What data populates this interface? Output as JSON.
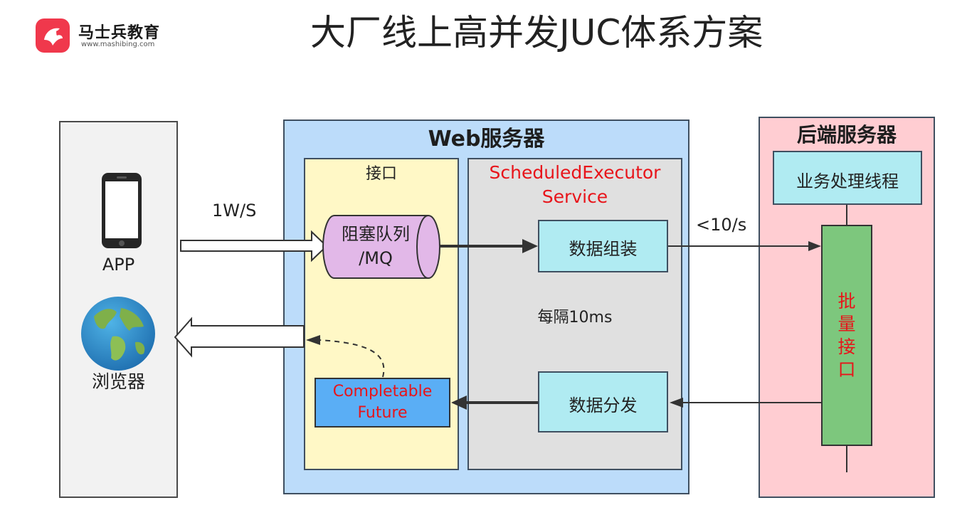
{
  "header": {
    "brand_name": "马士兵教育",
    "brand_url": "www.mashibing.com",
    "title": "大厂线上高并发JUC体系方案"
  },
  "client": {
    "app_label": "APP",
    "browser_label": "浏览器",
    "app_icon": "smartphone-icon",
    "browser_icon": "globe-icon"
  },
  "web_server": {
    "title": "Web服务器",
    "interface_title": "接口",
    "queue_label_line1": "阻塞队列",
    "queue_label_line2": "/MQ",
    "scheduler_line1": "ScheduledExecutor",
    "scheduler_line2": "Service",
    "assemble_label": "数据组装",
    "interval_label": "每隔10ms",
    "dispatch_label": "数据分发",
    "completable_line1": "Completable",
    "completable_line2": "Future"
  },
  "backend": {
    "title": "后端服务器",
    "worker_label": "业务处理线程",
    "batch_label": "批\n量\n接\n口"
  },
  "rates": {
    "incoming": "1W/S",
    "outgoing": "<10/s"
  },
  "colors": {
    "web_bg": "#bcdcfa",
    "interface_bg": "#fff8c6",
    "scheduler_bg": "#e0e0e0",
    "backend_bg": "#ffcdd2",
    "task_box": "#b0ebf2",
    "completable_box": "#5aaef5",
    "batch_box": "#7dc77d",
    "queue_fill": "#e2b8e8",
    "highlight_text": "#e8141a",
    "brand": "#f0384c"
  }
}
